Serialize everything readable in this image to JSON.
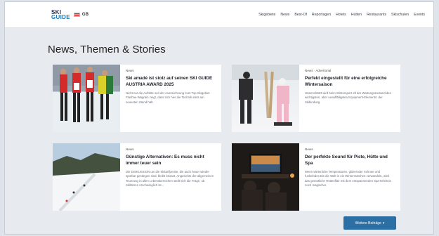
{
  "header": {
    "logo_top": "SKI",
    "logo_bottom": "GUIDE",
    "language": "GB",
    "nav": [
      "Skigebiete",
      "News",
      "Best-Of",
      "Reportagen",
      "Hotels",
      "Hütten",
      "Restaurants",
      "Skischulen",
      "Events"
    ]
  },
  "page_title": "News, Themen & Stories",
  "cards": [
    {
      "category": "News",
      "title": "Ski amadé ist stolz auf seinen SKI GUIDE AUSTRIA AWARD 2025",
      "excerpt": "Nicht nur die Auftritte seit der Auszeichnung zum Top-Skigebiet Flachau-Wagrain zeigt, dass sich hier die Technik stets am neuesten Stand hält."
    },
    {
      "category": "News · Advertorial",
      "title": "Perfekt eingestellt für eine erfolgreiche Wintersaison",
      "excerpt": "Unterschätzt wird beim Wintersport oft der Wartungszustand des wichtigsten, aber unauffälligsten Equipment-Elements: der Skibindung."
    },
    {
      "category": "News",
      "title": "Günstige Alternativen: Es muss nicht immer teuer sein",
      "excerpt": "Die DISKUSSION um die Skitarifpreise, die auch heuer wieder spürbar gestiegen sind, bleibt brisant. Angesichts der allgemeinen Teuerung in allen Lebensbereichen stellt sich die Frage, ob Skifahren erschwinglich ist..."
    },
    {
      "category": "News",
      "title": "Der perfekte Sound für Piste, Hütte und Spa",
      "excerpt": "Wenn winterliche Temperaturen, glitzernder Schnee und funkelndes Eis die Welt in ein Wintermärchen verwandeln, wird das gemütliche Hüttenflair mit dem entspannenden Spa-Erlebnis noch magischer."
    }
  ],
  "more_button": "Weitere Beiträge"
}
